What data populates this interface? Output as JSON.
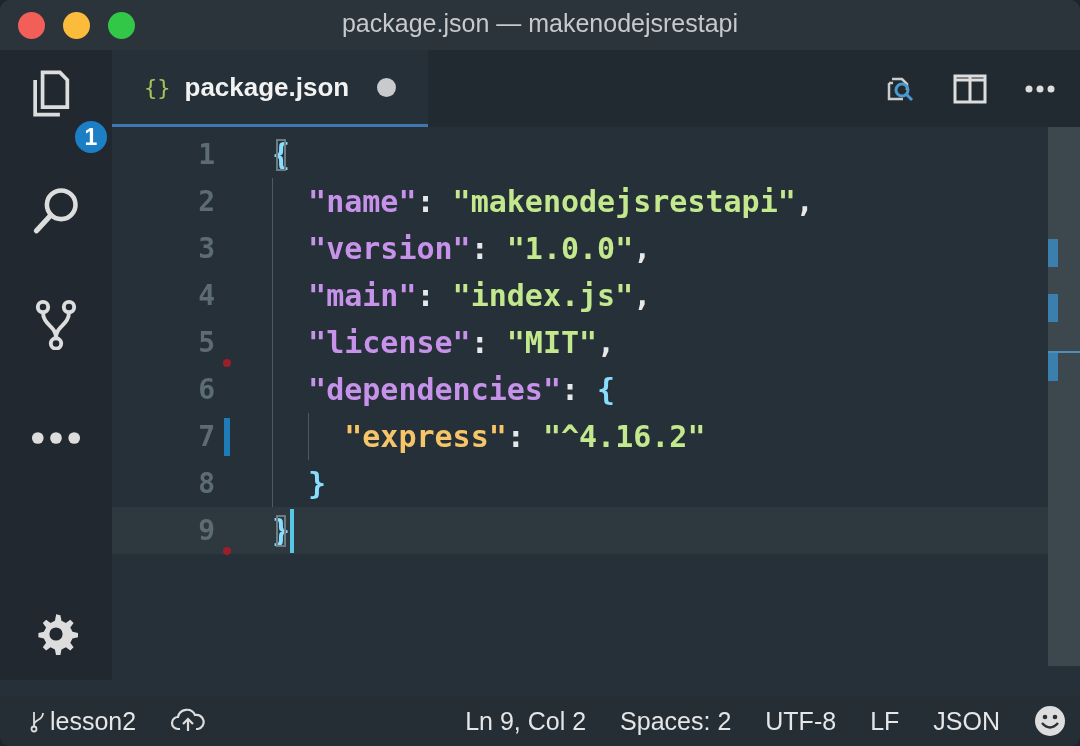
{
  "window": {
    "title": "package.json — makenodejsrestapi"
  },
  "activity_bar": {
    "items": [
      {
        "kind": "files",
        "badge": "1"
      },
      {
        "kind": "search"
      },
      {
        "kind": "source-control"
      },
      {
        "kind": "more"
      }
    ],
    "bottom": [
      {
        "kind": "settings"
      }
    ]
  },
  "tabs": [
    {
      "label": "package.json",
      "icon": "{}",
      "selected": true,
      "modified": true
    }
  ],
  "editor": {
    "lines": [
      {
        "number": "1",
        "current": false,
        "modified": false,
        "deleted": false,
        "tokens": [
          {
            "text": "{",
            "kind": "bracket-match"
          }
        ],
        "children": [
          {
            "number": "2",
            "current": false,
            "modified": false,
            "deleted": false,
            "tokens": [
              {
                "text": "\"name\"",
                "kind": "key"
              },
              {
                "text": ": ",
                "kind": "punct"
              },
              {
                "text": "\"makenodejsrestapi\"",
                "kind": "string"
              },
              {
                "text": ",",
                "kind": "punct"
              }
            ]
          },
          {
            "number": "3",
            "current": false,
            "modified": false,
            "deleted": false,
            "tokens": [
              {
                "text": "\"version\"",
                "kind": "key"
              },
              {
                "text": ": ",
                "kind": "punct"
              },
              {
                "text": "\"1.0.0\"",
                "kind": "string"
              },
              {
                "text": ",",
                "kind": "punct"
              }
            ]
          },
          {
            "number": "4",
            "current": false,
            "modified": false,
            "deleted": false,
            "tokens": [
              {
                "text": "\"main\"",
                "kind": "key"
              },
              {
                "text": ": ",
                "kind": "punct"
              },
              {
                "text": "\"index.js\"",
                "kind": "string"
              },
              {
                "text": ",",
                "kind": "punct"
              }
            ]
          },
          {
            "number": "5",
            "current": false,
            "modified": false,
            "deleted": true,
            "tokens": [
              {
                "text": "\"license\"",
                "kind": "key"
              },
              {
                "text": ": ",
                "kind": "punct"
              },
              {
                "text": "\"MIT\"",
                "kind": "string"
              },
              {
                "text": ",",
                "kind": "punct"
              }
            ]
          },
          {
            "number": "6",
            "current": false,
            "modified": false,
            "deleted": false,
            "tokens": [
              {
                "text": "\"dependencies\"",
                "kind": "key"
              },
              {
                "text": ": ",
                "kind": "punct"
              },
              {
                "text": "{",
                "kind": "brace"
              }
            ],
            "children": [
              {
                "number": "7",
                "current": false,
                "modified": true,
                "deleted": false,
                "tokens": [
                  {
                    "text": "\"express\"",
                    "kind": "key2"
                  },
                  {
                    "text": ": ",
                    "kind": "punct"
                  },
                  {
                    "text": "\"^4.16.2\"",
                    "kind": "string"
                  }
                ]
              }
            ]
          },
          {
            "number": "8",
            "current": false,
            "modified": false,
            "deleted": false,
            "tokens": [
              {
                "text": "}",
                "kind": "brace"
              }
            ]
          }
        ]
      },
      {
        "number": "9",
        "current": true,
        "modified": false,
        "deleted": true,
        "tokens": [
          {
            "text": "}",
            "kind": "bracket-match"
          }
        ]
      }
    ]
  },
  "status_bar": {
    "left": [
      {
        "kind": "branch",
        "text": "lesson2"
      },
      {
        "kind": "publish"
      }
    ],
    "right": [
      {
        "kind": "text",
        "text": "Ln 9, Col 2"
      },
      {
        "kind": "text",
        "text": "Spaces: 2"
      },
      {
        "kind": "text",
        "text": "UTF-8"
      },
      {
        "kind": "text",
        "text": "LF"
      },
      {
        "kind": "text",
        "text": "JSON"
      },
      {
        "kind": "feedback"
      }
    ]
  }
}
